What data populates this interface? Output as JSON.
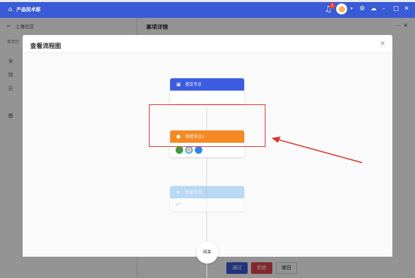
{
  "titlebar": {
    "title": "产品技术部",
    "notification_count": "1"
  },
  "app": {
    "left_panel": {
      "header": "上海社区",
      "section_label": "事项空",
      "rows": [
        "全",
        "钱",
        "日",
        "",
        "模",
        ""
      ]
    },
    "right_panel": {
      "title": "事项详情"
    },
    "buttons": {
      "pass": "通过",
      "reject": "拒绝",
      "close": "撤回"
    }
  },
  "modal": {
    "title": "查看流程图",
    "close_symbol": "×",
    "nodes": {
      "submit": "提交节点",
      "approve": "审批节点1",
      "cc": "抄送节点",
      "end": "结束"
    }
  },
  "colors": {
    "brand": "#3a5bd6",
    "submit": "#3c5ce0",
    "approve": "#f58a24",
    "cc": "#84bdf0",
    "highlight": "#e03030"
  }
}
